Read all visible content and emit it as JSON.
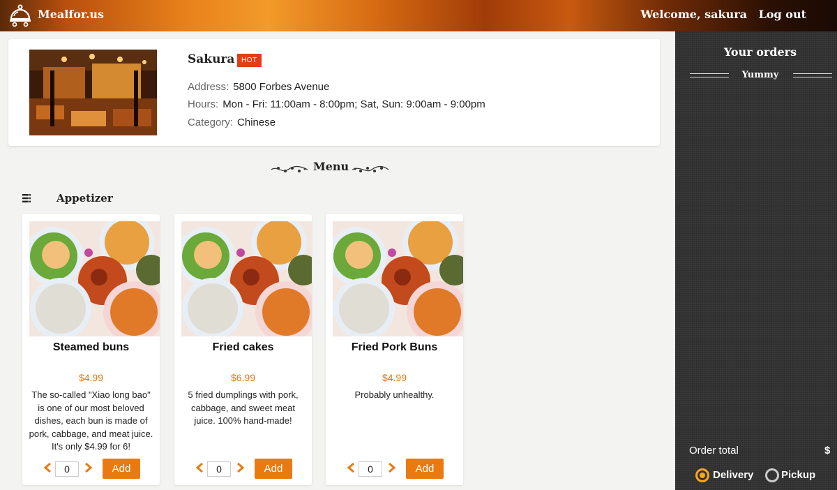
{
  "header": {
    "brand": "Mealfor.us",
    "welcome": "Welcome, sakura",
    "logout": "Log out"
  },
  "restaurant": {
    "name": "Sakura",
    "badge": "HOT",
    "address_label": "Address:",
    "address": "5800 Forbes Avenue",
    "hours_label": "Hours:",
    "hours": "Mon - Fri: 11:00am - 8:00pm; Sat, Sun: 9:00am - 9:00pm",
    "category_label": "Category:",
    "category": "Chinese"
  },
  "menu": {
    "title": "Menu",
    "category": "Appetizer",
    "items": [
      {
        "name": "Steamed buns",
        "price": "$4.99",
        "description": "The so-called \"Xiao long bao\" is one of our most beloved dishes, each bun is made of pork, cabbage, and meat juice. It's only $4.99 for 6!",
        "qty": "0",
        "add": "Add"
      },
      {
        "name": "Fried cakes",
        "price": "$6.99",
        "description": "5 fried dumplings with pork, cabbage, and sweet meat juice. 100% hand-made!",
        "qty": "0",
        "add": "Add"
      },
      {
        "name": "Fried Pork Buns",
        "price": "$4.99",
        "description": "Probably unhealthy.",
        "qty": "0",
        "add": "Add"
      }
    ]
  },
  "orders": {
    "title": "Your orders",
    "subtitle": "Yummy",
    "total_label": "Order total",
    "total_value": "$",
    "delivery": "Delivery",
    "pickup": "Pickup",
    "selected": "delivery"
  },
  "colors": {
    "accent": "#ea7a10",
    "price": "#e07b0e",
    "badge": "#e43b1a",
    "sidebar": "#333333",
    "radio_on": "#f7a61a"
  },
  "icons": {
    "logo": "cloche-icon",
    "category": "list-icon",
    "decrement": "chevron-left-icon",
    "increment": "chevron-right-icon"
  }
}
